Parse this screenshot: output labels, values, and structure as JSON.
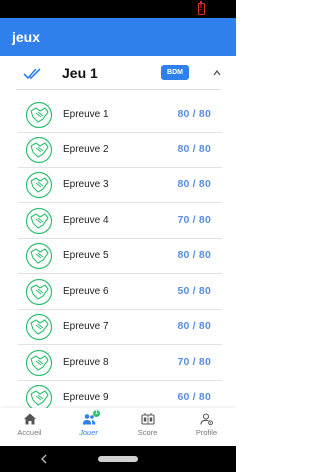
{
  "app": {
    "title": "jeux"
  },
  "game": {
    "title": "Jeu 1",
    "badge": "BDM"
  },
  "epreuves": [
    {
      "label": "Epreuve 1",
      "score": "80 / 80"
    },
    {
      "label": "Epreuve 2",
      "score": "80 / 80"
    },
    {
      "label": "Epreuve 3",
      "score": "80 / 80"
    },
    {
      "label": "Epreuve 4",
      "score": "70 / 80"
    },
    {
      "label": "Epreuve 5",
      "score": "80 / 80"
    },
    {
      "label": "Epreuve 6",
      "score": "50 / 80"
    },
    {
      "label": "Epreuve 7",
      "score": "80 / 80"
    },
    {
      "label": "Epreuve 8",
      "score": "70 / 80"
    },
    {
      "label": "Epreuve 9",
      "score": "60 / 80"
    }
  ],
  "bottom_nav": {
    "accueil": "Accueil",
    "jouer": "Jouer",
    "jouer_badge": "1",
    "score": "Score",
    "profile": "Profile"
  },
  "icons": {
    "status": "battery-alert-icon",
    "game": "double-check-icon",
    "collapse": "chevron-up-icon",
    "epreuve": "handshake-icon",
    "accueil": "home-icon",
    "jouer": "people-icon",
    "score": "scoreboard-icon",
    "profile": "person-settings-icon",
    "back": "back-triangle-icon"
  },
  "colors": {
    "primary": "#2f80ed",
    "score": "#5a8ee0",
    "icon_green": "#2fbf71",
    "battery_alert": "#d32f2f"
  }
}
